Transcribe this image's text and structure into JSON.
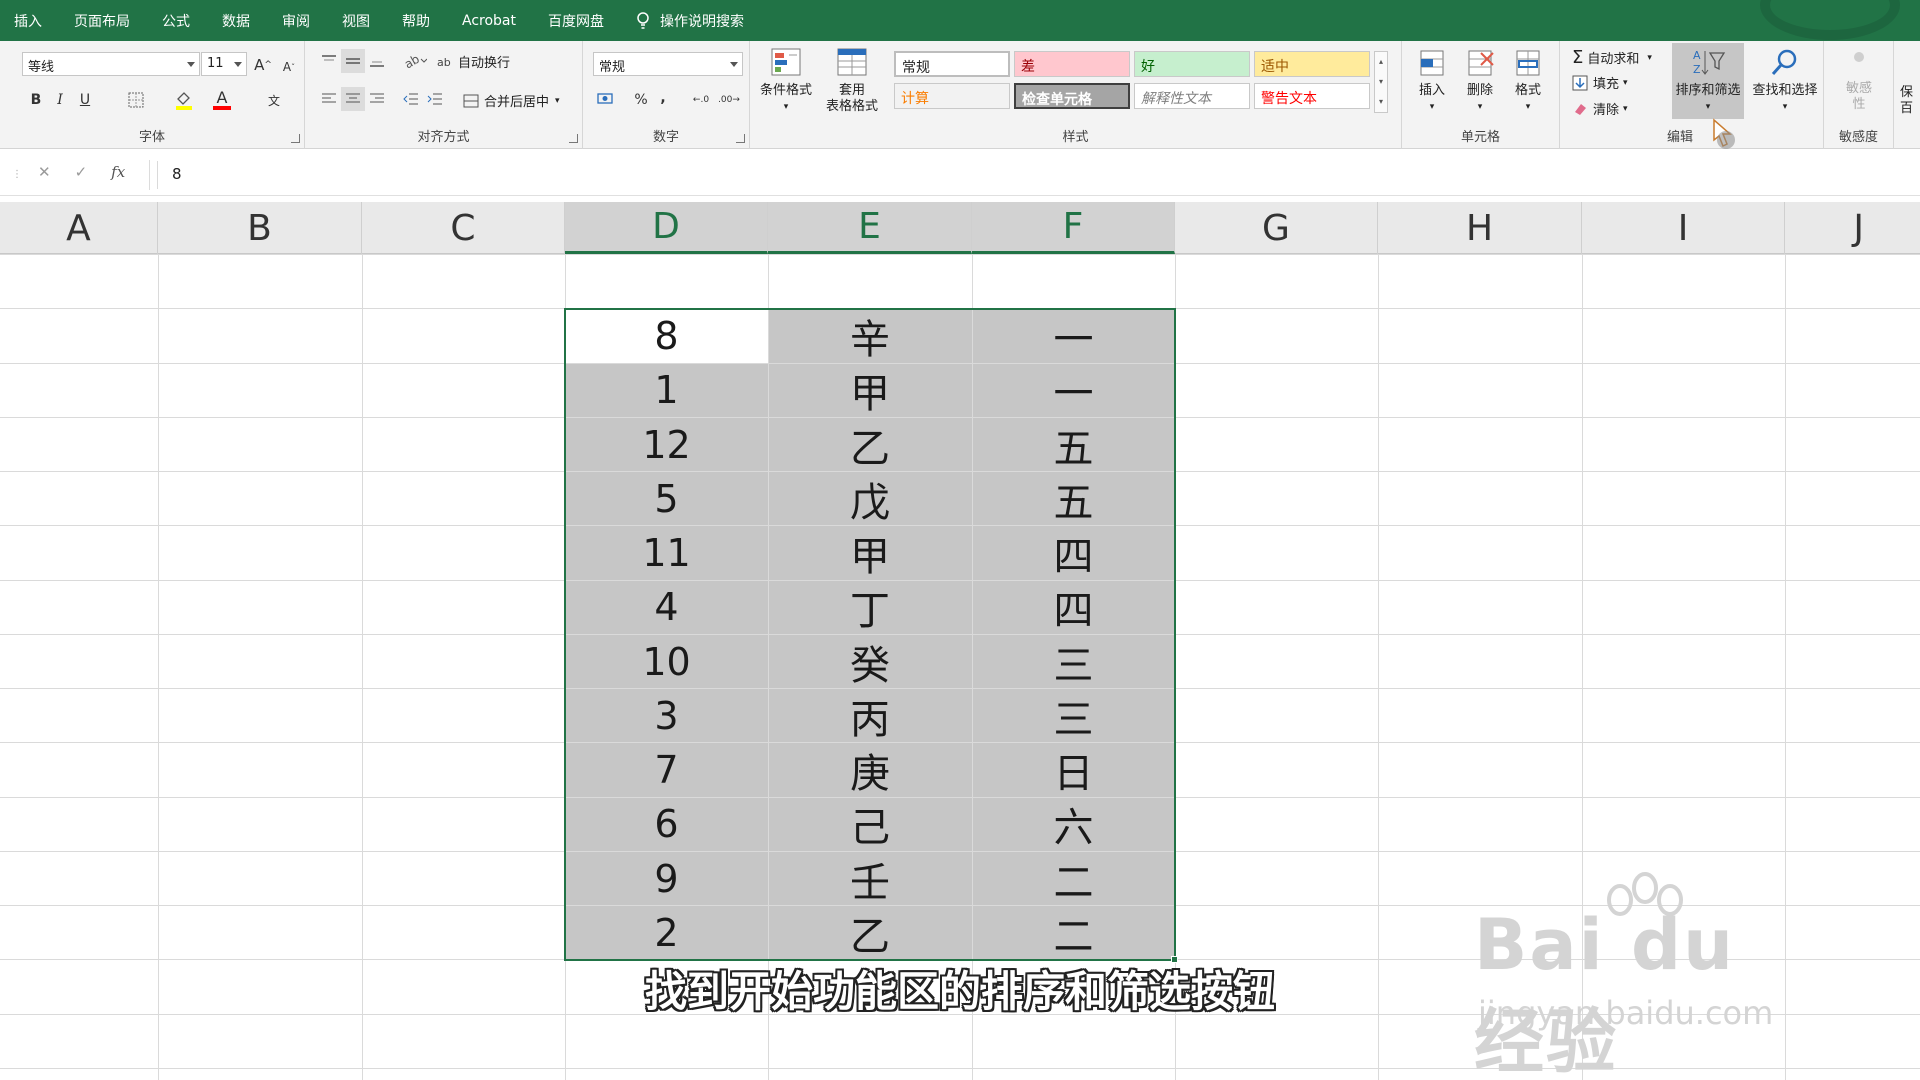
{
  "tabs": [
    "插入",
    "页面布局",
    "公式",
    "数据",
    "审阅",
    "视图",
    "帮助",
    "Acrobat",
    "百度网盘"
  ],
  "tell_me": "操作说明搜索",
  "ribbon": {
    "font": {
      "name": "等线",
      "size": "11",
      "bold": "B",
      "italic": "I",
      "underline": "U",
      "title": "字体"
    },
    "alignment": {
      "wrap": "自动换行",
      "merge": "合并后居中",
      "title": "对齐方式"
    },
    "number": {
      "format": "常规",
      "percent": "%",
      "comma": ",",
      "title": "数字"
    },
    "styles": {
      "cond_format": "条件格式",
      "table_format_1": "套用",
      "table_format_2": "表格格式",
      "cells": [
        {
          "label": "常规",
          "color": "#222222",
          "bg": "#ffffff"
        },
        {
          "label": "差",
          "color": "#9c0006",
          "bg": "#ffc7ce"
        },
        {
          "label": "好",
          "color": "#006100",
          "bg": "#c6efce"
        },
        {
          "label": "适中",
          "color": "#9c5700",
          "bg": "#ffeb9c"
        },
        {
          "label": "计算",
          "color": "#fa7d00",
          "bg": "#f2f2f2"
        },
        {
          "label": "检查单元格",
          "color": "#ffffff",
          "bg": "#a5a5a5"
        },
        {
          "label": "解释性文本",
          "color": "#7f7f7f",
          "bg": "#ffffff"
        },
        {
          "label": "警告文本",
          "color": "#ff0000",
          "bg": "#ffffff"
        }
      ],
      "title": "样式"
    },
    "cells_group": {
      "insert": "插入",
      "delete": "删除",
      "format": "格式",
      "title": "单元格"
    },
    "editing": {
      "autosum": "自动求和",
      "fill": "填充",
      "clear": "清除",
      "sort_filter": "排序和筛选",
      "find_select": "查找和选择",
      "title": "编辑"
    },
    "sensitivity": {
      "label_1": "敏感",
      "label_2": "性",
      "title": "敏感度"
    },
    "extra_1": "保",
    "extra_2": "百"
  },
  "formula_bar": {
    "fx": "fx",
    "value": "8"
  },
  "columns": [
    "A",
    "B",
    "C",
    "D",
    "E",
    "F",
    "G",
    "H",
    "I",
    "J"
  ],
  "rows": [
    {
      "d": "8",
      "e": "辛",
      "f": "一"
    },
    {
      "d": "1",
      "e": "甲",
      "f": "一"
    },
    {
      "d": "12",
      "e": "乙",
      "f": "五"
    },
    {
      "d": "5",
      "e": "戊",
      "f": "五"
    },
    {
      "d": "11",
      "e": "甲",
      "f": "四"
    },
    {
      "d": "4",
      "e": "丁",
      "f": "四"
    },
    {
      "d": "10",
      "e": "癸",
      "f": "三"
    },
    {
      "d": "3",
      "e": "丙",
      "f": "三"
    },
    {
      "d": "7",
      "e": "庚",
      "f": "日"
    },
    {
      "d": "6",
      "e": "己",
      "f": "六"
    },
    {
      "d": "9",
      "e": "壬",
      "f": "二"
    },
    {
      "d": "2",
      "e": "乙",
      "f": "二"
    }
  ],
  "caption": "找到开始功能区的排序和筛选按钮",
  "watermark": {
    "brand": "Bai du 经验",
    "url": "jingyan.baidu.com"
  },
  "colors": {
    "accent": "#217346",
    "selection": "#c6c6c6"
  }
}
